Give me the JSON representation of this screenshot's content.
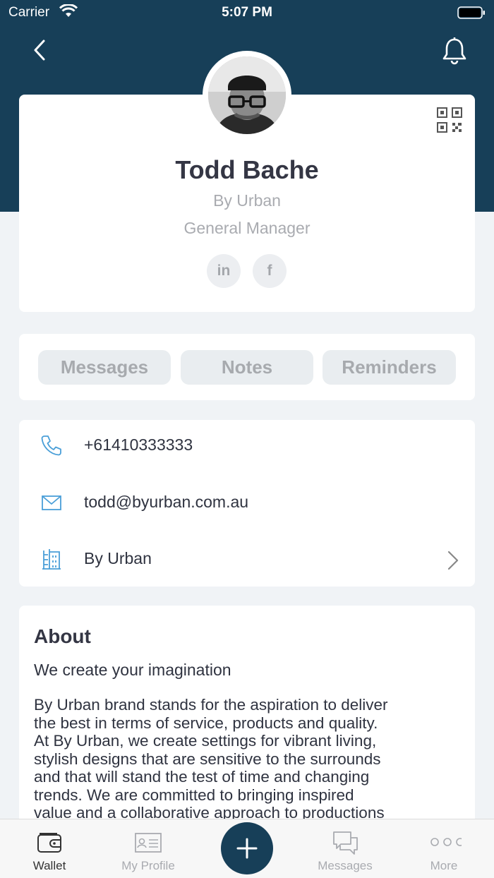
{
  "status_bar": {
    "carrier": "Carrier",
    "time": "5:07 PM"
  },
  "profile": {
    "name": "Todd Bache",
    "company": "By Urban",
    "job_title": "General Manager",
    "social": {
      "linkedin": "in",
      "facebook": "f"
    }
  },
  "tabs": [
    {
      "label": "Messages"
    },
    {
      "label": "Notes"
    },
    {
      "label": "Reminders"
    }
  ],
  "contact": {
    "phone": "+61410333333",
    "email": "todd@byurban.com.au",
    "company": "By Urban"
  },
  "about": {
    "title": "About",
    "tagline": "We create your imagination",
    "lines": [
      "By Urban brand stands for the aspiration to deliver",
      "the best in terms of service, products and quality.",
      "At By Urban, we create settings for vibrant living,",
      "stylish designs that are sensitive to the surrounds",
      "and that will stand the test of time and changing",
      "trends. We are committed to bringing inspired",
      "value and a collaborative approach to productions"
    ]
  },
  "tab_bar": {
    "wallet": "Wallet",
    "my_profile": "My Profile",
    "messages": "Messages",
    "more": "More"
  },
  "colors": {
    "header": "#173f58",
    "accent_icon": "#4a9fd8",
    "tab_bg": "#e9edf0",
    "muted_text": "#a9abb0"
  },
  "icons": [
    "wifi-icon",
    "battery-icon",
    "back-icon",
    "bell-icon",
    "qr-code-icon",
    "phone-icon",
    "email-icon",
    "building-icon",
    "chevron-right-icon",
    "wallet-icon",
    "id-card-icon",
    "plus-icon",
    "chat-icon",
    "more-dots-icon"
  ]
}
